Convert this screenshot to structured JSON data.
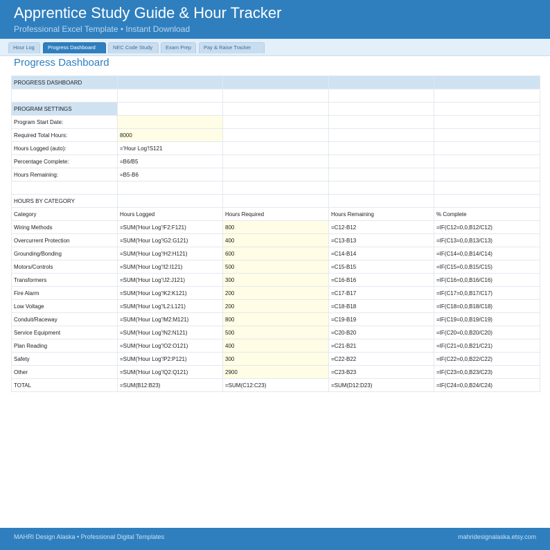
{
  "header": {
    "title": "Apprentice Study Guide & Hour Tracker",
    "subtitle": "Professional Excel Template  •  Instant Download"
  },
  "tabs": [
    {
      "label": "Hour Log",
      "active": false
    },
    {
      "label": "Progress Dashboard",
      "active": true
    },
    {
      "label": "NEC Code Study",
      "active": false
    },
    {
      "label": "Exam Prep",
      "active": false
    },
    {
      "label": "Pay & Raise Tracker",
      "active": false
    }
  ],
  "page_title": "Progress Dashboard",
  "dashboard": {
    "section_title": "PROGRESS DASHBOARD",
    "settings_title": "PROGRAM SETTINGS",
    "settings": [
      {
        "label": "Program Start Date:",
        "value": ""
      },
      {
        "label": "Required Total Hours:",
        "value": "8000"
      },
      {
        "label": "Hours Logged (auto):",
        "value": "='Hour Log'!S121"
      },
      {
        "label": "Percentage Complete:",
        "value": "=B6/B5"
      },
      {
        "label": "Hours Remaining:",
        "value": "=B5-B6"
      }
    ],
    "category_title": "HOURS BY CATEGORY",
    "columns": [
      "Category",
      "Hours Logged",
      "Hours Required",
      "Hours Remaining",
      "% Complete"
    ],
    "rows": [
      [
        "Wiring Methods",
        "=SUM('Hour Log'!F2:F121)",
        "800",
        "=C12-B12",
        "=IF(C12=0,0,B12/C12)"
      ],
      [
        "Overcurrent Protection",
        "=SUM('Hour Log'!G2:G121)",
        "400",
        "=C13-B13",
        "=IF(C13=0,0,B13/C13)"
      ],
      [
        "Grounding/Bonding",
        "=SUM('Hour Log'!H2:H121)",
        "600",
        "=C14-B14",
        "=IF(C14=0,0,B14/C14)"
      ],
      [
        "Motors/Controls",
        "=SUM('Hour Log'!I2:I121)",
        "500",
        "=C15-B15",
        "=IF(C15=0,0,B15/C15)"
      ],
      [
        "Transformers",
        "=SUM('Hour Log'!J2:J121)",
        "300",
        "=C16-B16",
        "=IF(C16=0,0,B16/C16)"
      ],
      [
        "Fire Alarm",
        "=SUM('Hour Log'!K2:K121)",
        "200",
        "=C17-B17",
        "=IF(C17=0,0,B17/C17)"
      ],
      [
        "Low Voltage",
        "=SUM('Hour Log'!L2:L121)",
        "200",
        "=C18-B18",
        "=IF(C18=0,0,B18/C18)"
      ],
      [
        "Conduit/Raceway",
        "=SUM('Hour Log'!M2:M121)",
        "800",
        "=C19-B19",
        "=IF(C19=0,0,B19/C19)"
      ],
      [
        "Service Equipment",
        "=SUM('Hour Log'!N2:N121)",
        "500",
        "=C20-B20",
        "=IF(C20=0,0,B20/C20)"
      ],
      [
        "Plan Reading",
        "=SUM('Hour Log'!O2:O121)",
        "400",
        "=C21-B21",
        "=IF(C21=0,0,B21/C21)"
      ],
      [
        "Safety",
        "=SUM('Hour Log'!P2:P121)",
        "300",
        "=C22-B22",
        "=IF(C22=0,0,B22/C22)"
      ],
      [
        "Other",
        "=SUM('Hour Log'!Q2:Q121)",
        "2900",
        "=C23-B23",
        "=IF(C23=0,0,B23/C23)"
      ]
    ],
    "total": [
      "TOTAL",
      "=SUM(B12:B23)",
      "=SUM(C12:C23)",
      "=SUM(D12:D23)",
      "=IF(C24=0,0,B24/C24)"
    ]
  },
  "footer": {
    "left": "MAHRI Design Alaska  •  Professional Digital Templates",
    "right": "mahridesignalaska.etsy.com"
  },
  "colors": {
    "brand": "#2f7fbf",
    "section_fill": "#cfe2f1",
    "input_fill": "#fffde5"
  }
}
